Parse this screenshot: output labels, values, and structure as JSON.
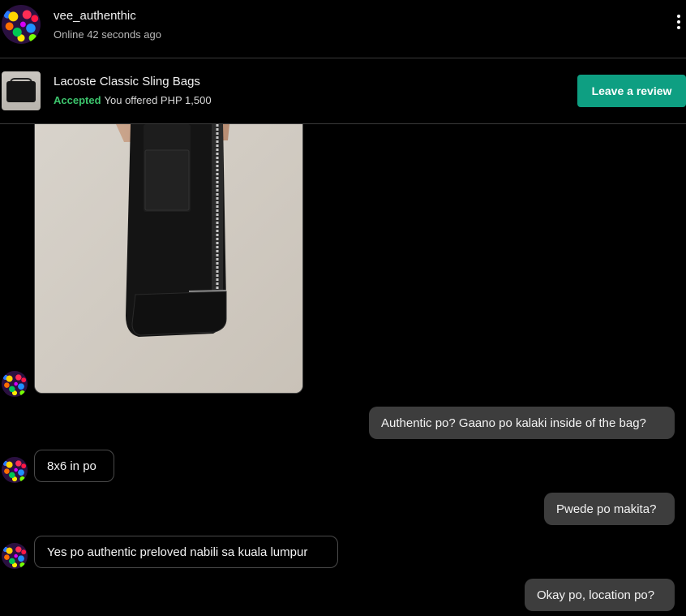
{
  "header": {
    "username": "vee_authenthic",
    "status": "Online 42 seconds ago"
  },
  "listing": {
    "title": "Lacoste Classic Sling Bags",
    "status_label": "Accepted",
    "offer_text": "You offered PHP 1,500",
    "review_button": "Leave a review"
  },
  "messages": [
    {
      "sender": "seller",
      "type": "image"
    },
    {
      "sender": "me",
      "text": "Authentic po? Gaano po kalaki inside of the bag?"
    },
    {
      "sender": "seller",
      "text": "8x6 in po"
    },
    {
      "sender": "me",
      "text": "Pwede po makita?"
    },
    {
      "sender": "seller",
      "text": "Yes po authentic preloved nabili sa kuala lumpur"
    },
    {
      "sender": "me",
      "text": "Okay po, location po?"
    }
  ],
  "colors": {
    "background": "#000000",
    "accent": "#0e9f82",
    "accepted": "#3cc46c",
    "outgoing_bubble": "#3d3d3d"
  },
  "icons": [
    "more-vertical-icon"
  ]
}
